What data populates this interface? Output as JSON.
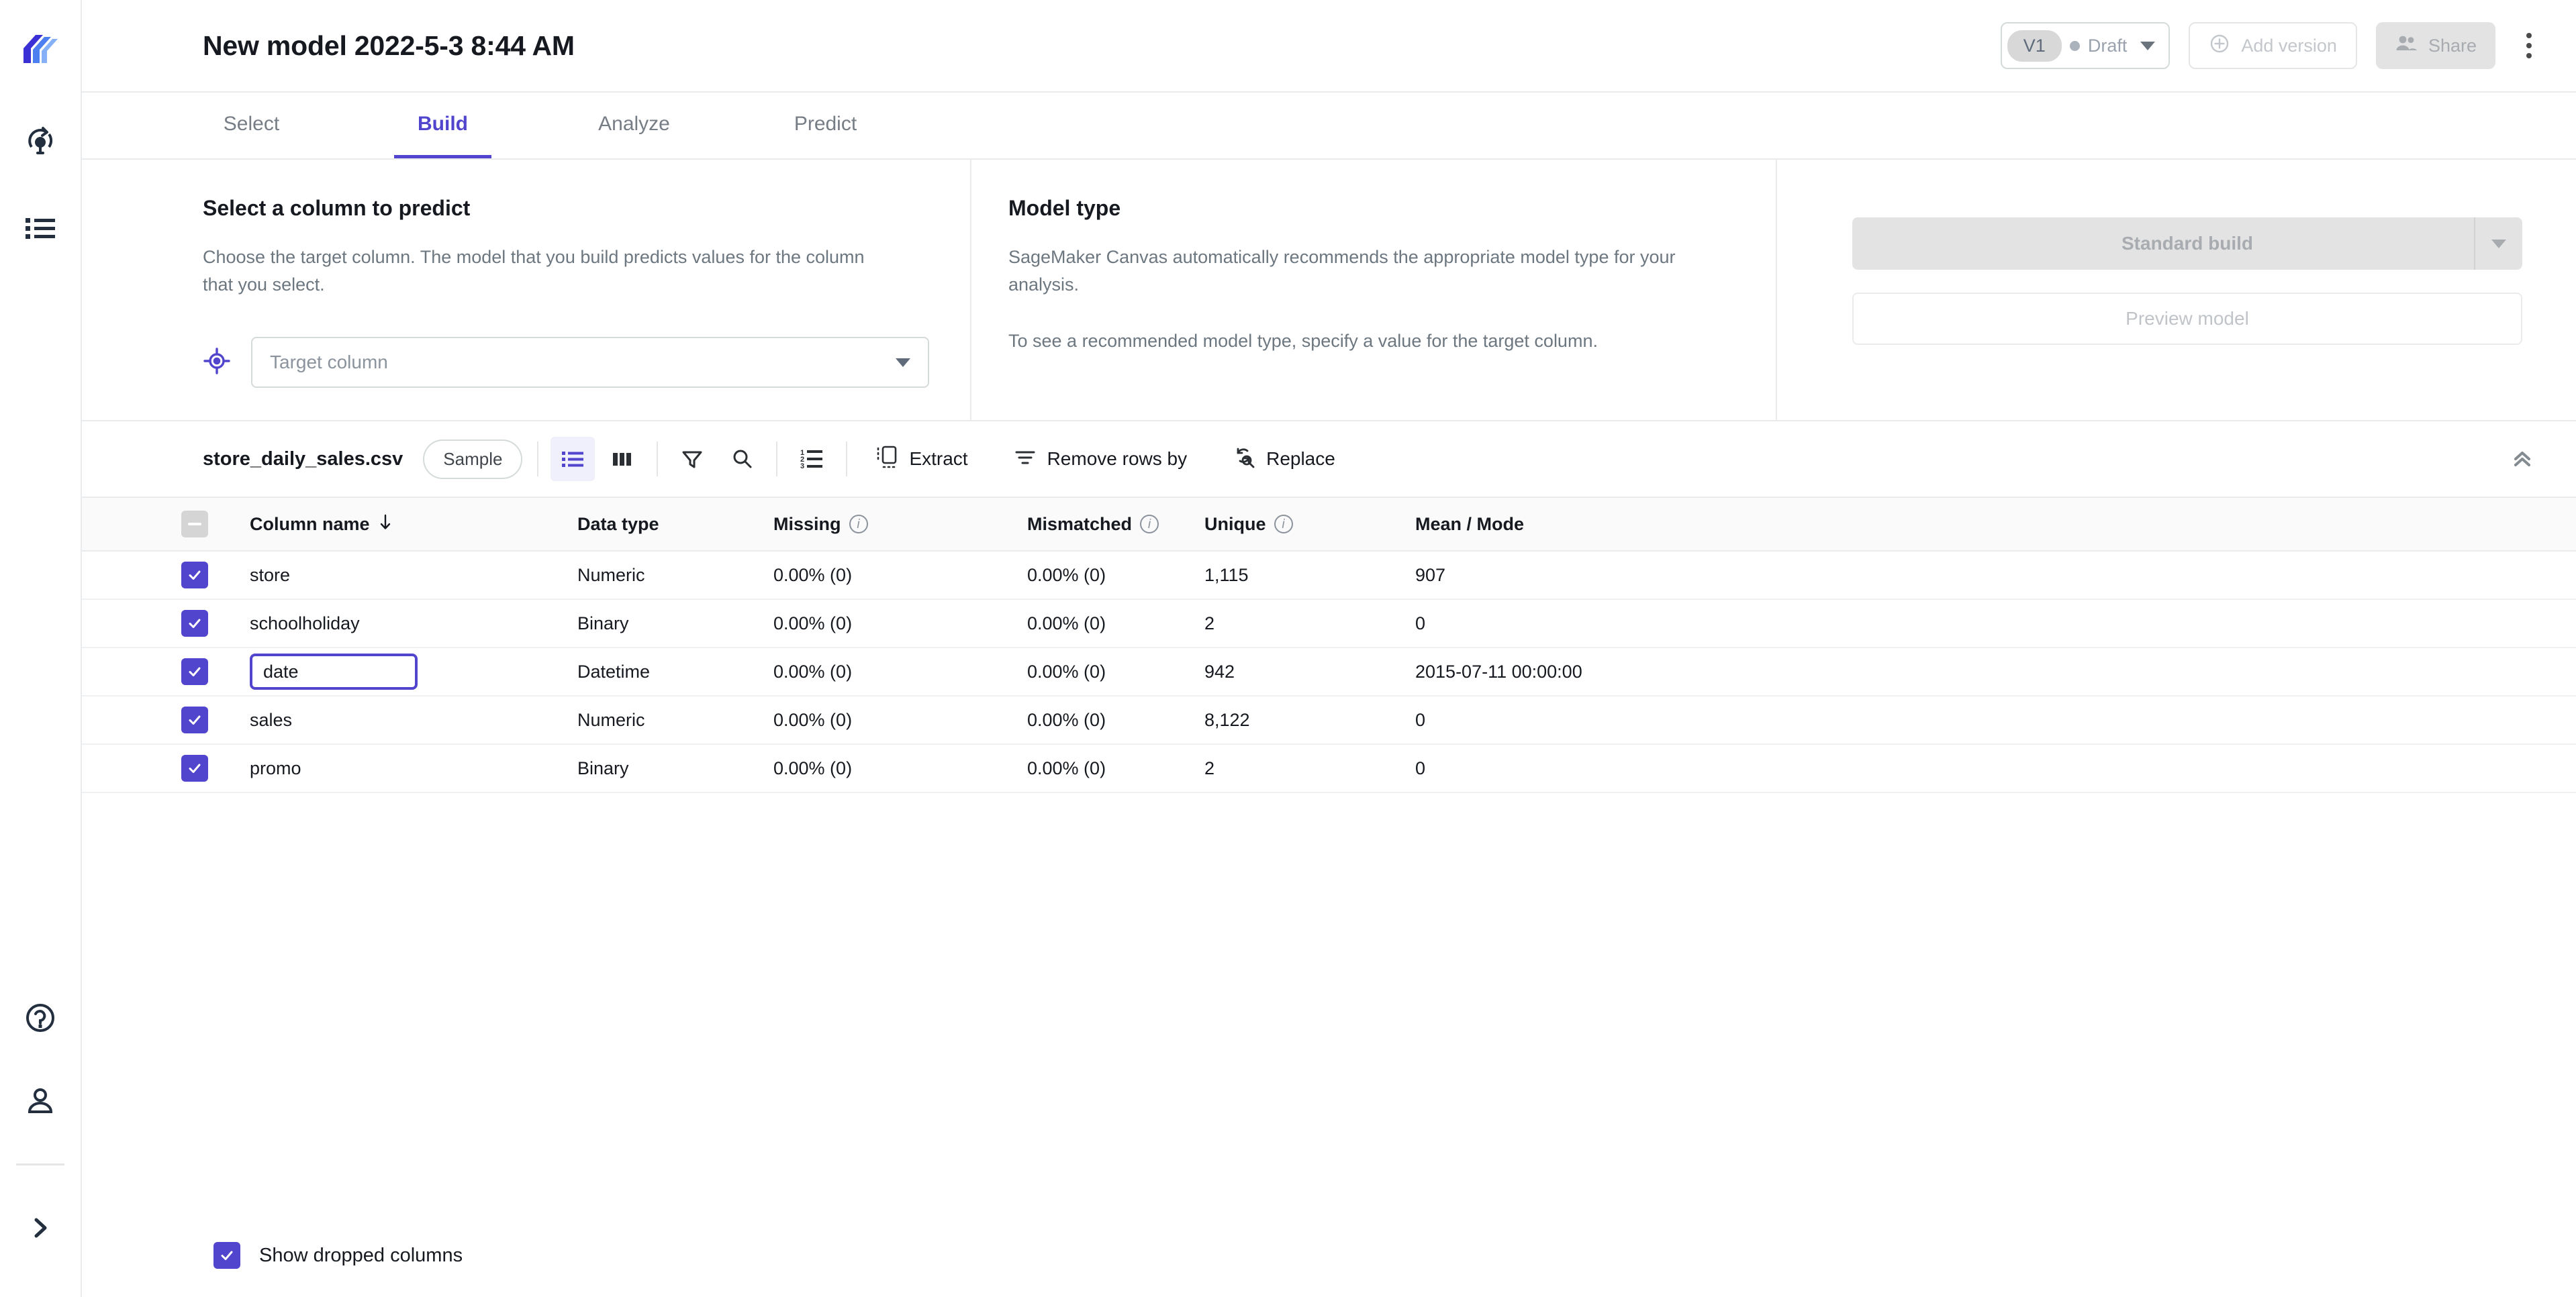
{
  "app": {
    "logo_icon": "sagemaker-canvas-logo",
    "rail_items": [
      {
        "icon": "model-lightbulb-icon",
        "name": "models"
      },
      {
        "icon": "datasets-list-icon",
        "name": "datasets"
      }
    ],
    "rail_bottom": [
      {
        "icon": "help-circle-icon",
        "name": "help"
      },
      {
        "icon": "user-account-icon",
        "name": "account"
      },
      {
        "icon": "chevron-right-icon",
        "name": "expand-rail"
      }
    ]
  },
  "header": {
    "title": "New model 2022-5-3 8:44 AM",
    "version_chip": "V1",
    "status_label": "Draft",
    "add_version_label": "Add version",
    "add_version_icon": "plus-circle-icon",
    "share_label": "Share",
    "share_icon": "people-icon",
    "more_icon": "kebab-menu-icon"
  },
  "tabs": [
    {
      "label": "Select",
      "active": false
    },
    {
      "label": "Build",
      "active": true
    },
    {
      "label": "Analyze",
      "active": false
    },
    {
      "label": "Predict",
      "active": false
    }
  ],
  "target_section": {
    "heading": "Select a column to predict",
    "description": "Choose the target column. The model that you build predicts values for the column that you select.",
    "icon": "target-crosshair-icon",
    "select_placeholder": "Target column",
    "select_value": ""
  },
  "model_type_section": {
    "heading": "Model type",
    "description_1": "SageMaker Canvas automatically recommends the appropriate model type for your analysis.",
    "description_2": "To see a recommended model type, specify a value for the target column."
  },
  "build_section": {
    "standard_build_label": "Standard build",
    "preview_model_label": "Preview model"
  },
  "data_toolbar": {
    "file_name": "store_daily_sales.csv",
    "sample_label": "Sample",
    "icons": [
      {
        "name": "list-view-icon",
        "active": true
      },
      {
        "name": "column-view-icon",
        "active": false
      },
      {
        "name": "filter-funnel-icon",
        "active": false
      },
      {
        "name": "search-icon",
        "active": false
      },
      {
        "name": "numbered-list-icon",
        "active": false
      }
    ],
    "extract_label": "Extract",
    "extract_icon": "extract-icon",
    "remove_rows_label": "Remove rows by",
    "remove_rows_icon": "filter-lines-icon",
    "replace_label": "Replace",
    "replace_icon": "replace-search-icon",
    "collapse_icon": "double-chevron-up-icon"
  },
  "table": {
    "headers": {
      "column_name": "Column name",
      "data_type": "Data type",
      "missing": "Missing",
      "mismatched": "Mismatched",
      "unique": "Unique",
      "mean_mode": "Mean / Mode"
    },
    "sort_indicator": "↓",
    "select_all_state": "indeterminate",
    "rows": [
      {
        "checked": true,
        "editing": false,
        "column_name": "store",
        "data_type": "Numeric",
        "missing": "0.00% (0)",
        "mismatched": "0.00% (0)",
        "unique": "1,115",
        "mean_mode": "907"
      },
      {
        "checked": true,
        "editing": false,
        "column_name": "schoolholiday",
        "data_type": "Binary",
        "missing": "0.00% (0)",
        "mismatched": "0.00% (0)",
        "unique": "2",
        "mean_mode": "0"
      },
      {
        "checked": true,
        "editing": true,
        "column_name": "date",
        "data_type": "Datetime",
        "missing": "0.00% (0)",
        "mismatched": "0.00% (0)",
        "unique": "942",
        "mean_mode": "2015-07-11 00:00:00"
      },
      {
        "checked": true,
        "editing": false,
        "column_name": "sales",
        "data_type": "Numeric",
        "missing": "0.00% (0)",
        "mismatched": "0.00% (0)",
        "unique": "8,122",
        "mean_mode": "0"
      },
      {
        "checked": true,
        "editing": false,
        "column_name": "promo",
        "data_type": "Binary",
        "missing": "0.00% (0)",
        "mismatched": "0.00% (0)",
        "unique": "2",
        "mean_mode": "0"
      }
    ]
  },
  "footer": {
    "show_dropped_label": "Show dropped columns",
    "show_dropped_checked": true
  },
  "colors": {
    "accent": "#5145cd",
    "border": "#e9ebed",
    "muted_text": "#6d7780",
    "disabled_bg": "#e3e3e3"
  }
}
